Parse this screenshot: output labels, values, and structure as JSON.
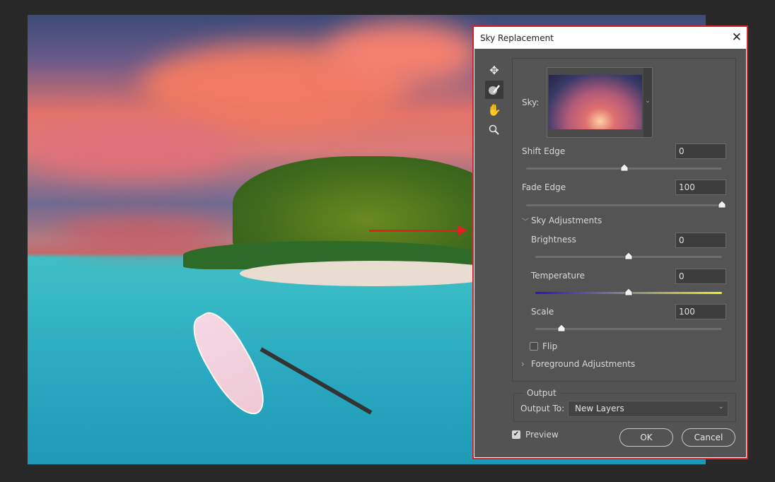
{
  "dialog": {
    "title": "Sky Replacement",
    "close_icon": "close-icon"
  },
  "tools": [
    {
      "icon": "move-icon"
    },
    {
      "icon": "sky-brush-icon",
      "active": true
    },
    {
      "icon": "hand-icon"
    },
    {
      "icon": "zoom-icon"
    }
  ],
  "sky": {
    "label": "Sky:",
    "preset": "sunset-clouds-thumbnail"
  },
  "shift_edge": {
    "label": "Shift Edge",
    "value": "0",
    "fraction": 0.5
  },
  "fade_edge": {
    "label": "Fade Edge",
    "value": "100",
    "fraction": 1.0
  },
  "sky_adjustments": {
    "label": "Sky Adjustments",
    "expanded": true,
    "brightness": {
      "label": "Brightness",
      "value": "0",
      "fraction": 0.5
    },
    "temperature": {
      "label": "Temperature",
      "value": "0",
      "fraction": 0.5,
      "gradient": [
        "#2a10c8",
        "#8a8a8a",
        "#f0f020"
      ]
    },
    "scale": {
      "label": "Scale",
      "value": "100",
      "fraction": 0.14
    },
    "flip": {
      "label": "Flip",
      "checked": false
    }
  },
  "foreground_adjustments": {
    "label": "Foreground Adjustments",
    "expanded": false
  },
  "output": {
    "group_label": "Output",
    "output_to_label": "Output To:",
    "output_to_value": "New Layers"
  },
  "preview": {
    "label": "Preview",
    "checked": true
  },
  "buttons": {
    "ok": "OK",
    "cancel": "Cancel"
  },
  "colors": {
    "highlight_border": "#d3212a",
    "arrow": "#e02020",
    "dialog_bg": "#535353"
  }
}
